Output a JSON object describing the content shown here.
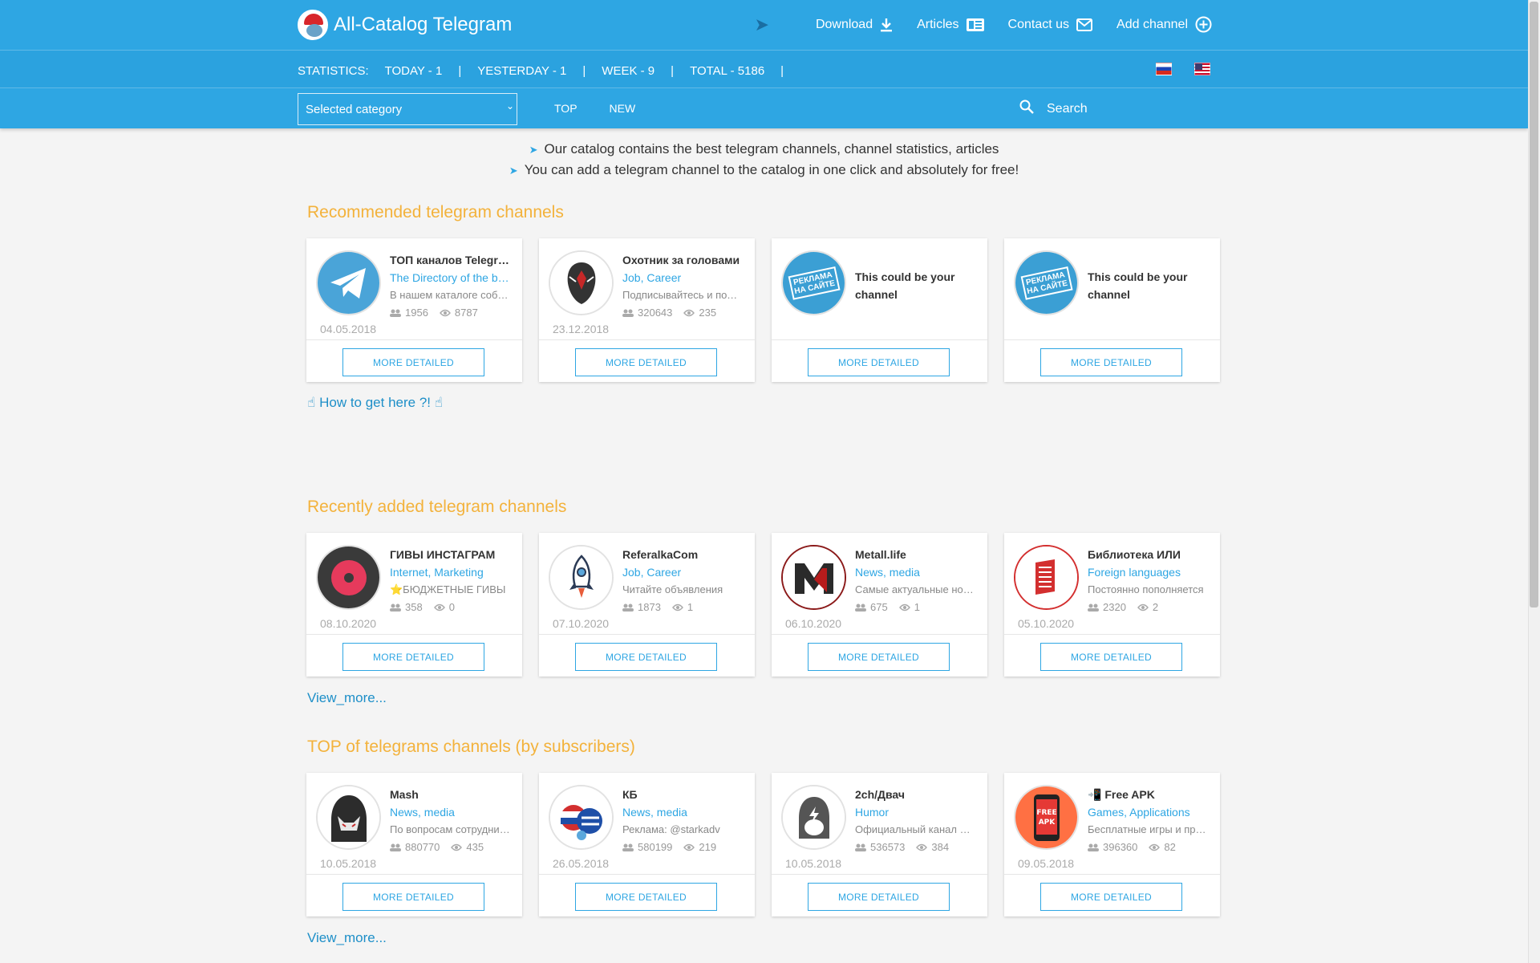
{
  "header": {
    "title": "All-Catalog Telegram",
    "nav": [
      {
        "label": "Download",
        "icon": "download-icon"
      },
      {
        "label": "Articles",
        "icon": "articles-icon"
      },
      {
        "label": "Contact us",
        "icon": "mail-icon"
      },
      {
        "label": "Add channel",
        "icon": "plus-circle-icon"
      }
    ],
    "stats": {
      "label": "STATISTICS:",
      "today": "TODAY - 1",
      "yesterday": "YESTERDAY - 1",
      "week": "WEEK - 9",
      "total": "TOTAL - 5186",
      "sep": "|"
    },
    "category_select": "Selected category",
    "subnav": [
      "TOP",
      "NEW"
    ],
    "search_placeholder": "Search"
  },
  "intro": [
    "Our catalog contains the best telegram channels, channel statistics, articles",
    "You can add a telegram channel to the catalog in one click and absolutely for free!"
  ],
  "recommended": {
    "title": "Recommended telegram channels",
    "cards": [
      {
        "name": "ТОП каналов Telegram",
        "category": "The Directory of the best",
        "desc": "В нашем каталоге собраны",
        "subs": "1956",
        "views": "8787",
        "date": "04.05.2018"
      },
      {
        "name": "Охотник за головами",
        "category": "Job, Career",
        "desc": "Подписывайтесь и получайте",
        "subs": "320643",
        "views": "235",
        "date": "23.12.2018"
      },
      {
        "placeholder": "This could be your channel",
        "badge": "РЕКЛАМА НА САЙТЕ"
      },
      {
        "placeholder": "This could be your channel",
        "badge": "РЕКЛАМА НА САЙТЕ"
      }
    ],
    "link": "How to get here ?!"
  },
  "recent": {
    "title": "Recently added telegram channels",
    "cards": [
      {
        "name": "ГИВЫ ИНСТАГРАМ",
        "category": "Internet, Marketing",
        "desc": "⭐БЮДЖЕТНЫЕ ГИВЫ",
        "subs": "358",
        "views": "0",
        "date": "08.10.2020"
      },
      {
        "name": "ReferalkaCom",
        "category": "Job, Career",
        "desc": "Читайте объявления",
        "subs": "1873",
        "views": "1",
        "date": "07.10.2020"
      },
      {
        "name": "Metall.life",
        "category": "News, media",
        "desc": "Самые актуальные новости",
        "subs": "675",
        "views": "1",
        "date": "06.10.2020"
      },
      {
        "name": "Библиотека ИЛИ",
        "category": "Foreign languages",
        "desc": "Постоянно пополняется",
        "subs": "2320",
        "views": "2",
        "date": "05.10.2020"
      }
    ],
    "link": "View_more..."
  },
  "top": {
    "title": "TOP of telegrams channels (by subscribers)",
    "cards": [
      {
        "name": "Mash",
        "category": "News, media",
        "desc": "По вопросам сотрудничества",
        "subs": "880770",
        "views": "435",
        "date": "10.05.2018"
      },
      {
        "name": "КБ",
        "category": "News, media",
        "desc": "Реклама: @starkadv",
        "subs": "580199",
        "views": "219",
        "date": "26.05.2018"
      },
      {
        "name": "2ch/Двач",
        "category": "Humor",
        "desc": "Официальный канал Двача",
        "subs": "536573",
        "views": "384",
        "date": "10.05.2018"
      },
      {
        "name": "📲 Free APK",
        "category": "Games, Applications",
        "desc": "Бесплатные игры и программы",
        "subs": "396360",
        "views": "82",
        "date": "09.05.2018"
      }
    ],
    "link": "View_more..."
  },
  "more_label": "MORE DETAILED",
  "colors": {
    "header": "#2ea6e3",
    "accent_title": "#f3b23b",
    "link": "#1e8fc8"
  }
}
